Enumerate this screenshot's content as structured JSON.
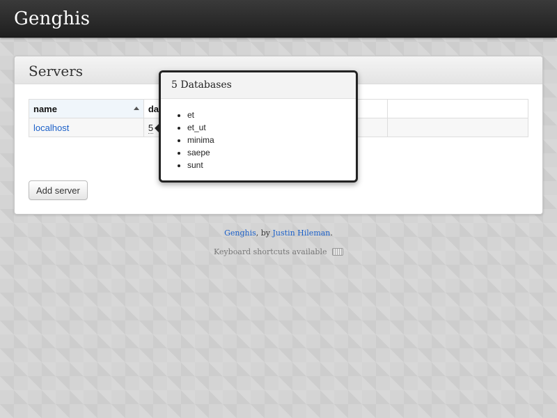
{
  "app": {
    "brand": "Genghis"
  },
  "servers_panel": {
    "title": "Servers",
    "columns": [
      "name",
      "databases"
    ],
    "rows": [
      {
        "name": "localhost",
        "databases": "5"
      }
    ],
    "add_button_label": "Add server"
  },
  "popover": {
    "title": "5 Databases",
    "items": [
      "et",
      "et_ut",
      "minima",
      "saepe",
      "sunt"
    ]
  },
  "footer": {
    "app_link": "Genghis",
    "by_text": ", by ",
    "author_link": "Justin Hileman",
    "end_text": ".",
    "shortcuts_text": "Keyboard shortcuts available",
    "shortcuts_icon": "keyboard-icon"
  }
}
